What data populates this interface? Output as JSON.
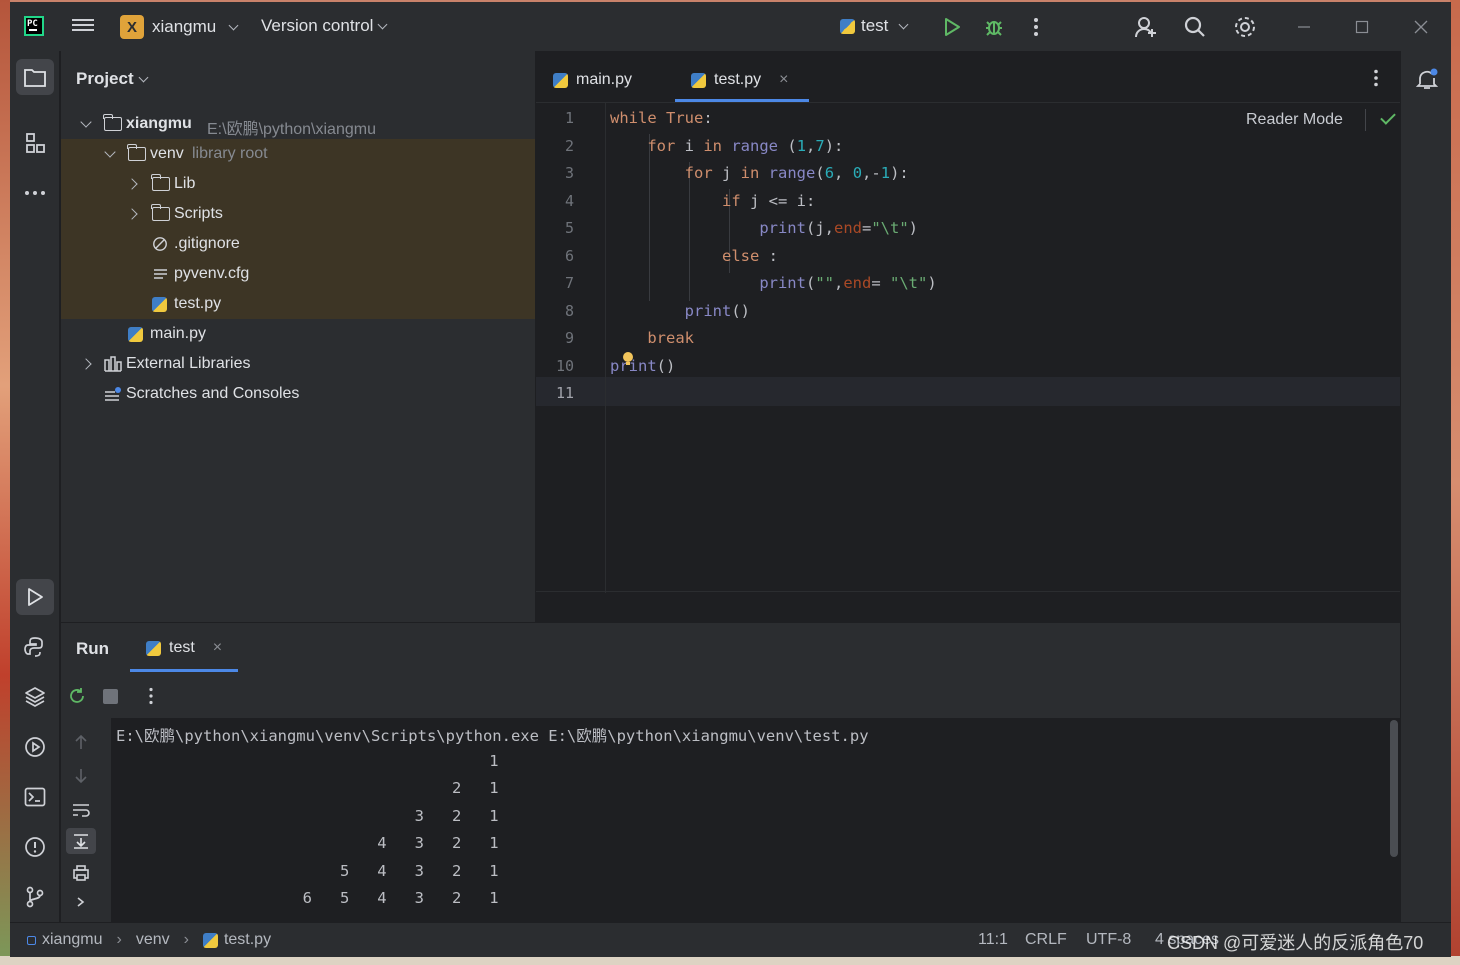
{
  "titlebar": {
    "logo_text": "PC",
    "project_badge": "X",
    "project_name": "xiangmu",
    "vcs_label": "Version control",
    "run_config": "test"
  },
  "project_panel": {
    "title": "Project",
    "tree": [
      {
        "label": "xiangmu",
        "hint": "E:\\欧鹏\\python\\xiangmu"
      },
      {
        "label": "venv",
        "hint": "library root"
      },
      {
        "label": "Lib"
      },
      {
        "label": "Scripts"
      },
      {
        "label": ".gitignore"
      },
      {
        "label": "pyvenv.cfg"
      },
      {
        "label": "test.py"
      },
      {
        "label": "main.py"
      },
      {
        "label": "External Libraries"
      },
      {
        "label": "Scratches and Consoles"
      }
    ]
  },
  "editor": {
    "tabs": [
      {
        "label": "main.py"
      },
      {
        "label": "test.py",
        "close": "×"
      }
    ],
    "reader_mode": "Reader Mode",
    "line_numbers": [
      "1",
      "2",
      "3",
      "4",
      "5",
      "6",
      "7",
      "8",
      "9",
      "10",
      "11"
    ]
  },
  "run_panel": {
    "title": "Run",
    "tab_label": "test",
    "tab_close": "×",
    "command": "E:\\欧鹏\\python\\xiangmu\\venv\\Scripts\\python.exe E:\\欧鹏\\python\\xiangmu\\venv\\test.py",
    "output_lines": [
      "                                        1",
      "                                    2   1",
      "                                3   2   1",
      "                            4   3   2   1",
      "                        5   4   3   2   1",
      "                    6   5   4   3   2   1"
    ]
  },
  "statusbar": {
    "breadcrumb": [
      "xiangmu",
      "venv",
      "test.py"
    ],
    "position": "11:1",
    "line_sep": "CRLF",
    "encoding": "UTF-8",
    "indent": "4 spaces",
    "watermark": "CSDN @可爱迷人的反派角色70"
  },
  "colors": {
    "accent": "#4c88e6",
    "keyword": "#cf8e6d",
    "builtin": "#8888c6",
    "number": "#2aacb8",
    "string": "#6aab73",
    "run_green": "#5fb865",
    "project_badge": "#e0a33a"
  },
  "icons": [
    "pycharm-logo-icon",
    "hamburger-menu-icon",
    "python-file-icon",
    "run-icon",
    "debug-icon",
    "more-vertical-icon",
    "add-user-icon",
    "search-icon",
    "settings-gear-icon",
    "minimize-icon",
    "maximize-icon",
    "close-icon",
    "folder-icon",
    "structure-icon",
    "more-horizontal-icon",
    "run-tool-icon",
    "python-console-icon",
    "layers-icon",
    "services-icon",
    "terminal-icon",
    "problems-icon",
    "git-branch-icon",
    "notifications-icon",
    "rerun-icon",
    "stop-icon",
    "arrow-up-icon",
    "arrow-down-icon",
    "soft-wrap-icon",
    "scroll-to-end-icon",
    "print-icon",
    "expand-icon",
    "bulb-icon",
    "check-icon"
  ]
}
